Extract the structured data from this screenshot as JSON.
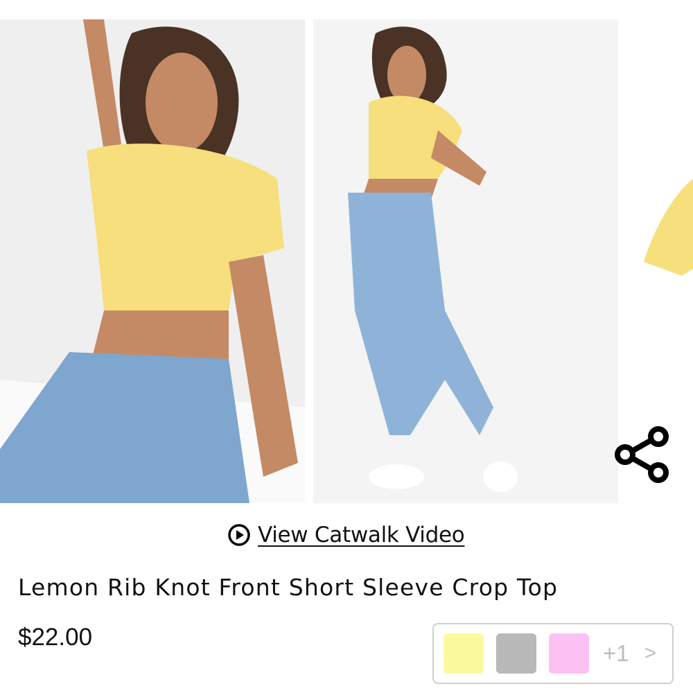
{
  "gallery": {
    "images": [
      {
        "alt": "front-view"
      },
      {
        "alt": "back-view"
      },
      {
        "alt": "detail-view"
      }
    ]
  },
  "video_link": {
    "label": "View Catwalk Video",
    "icon": "play-circle-icon"
  },
  "product": {
    "title": "Lemon Rib Knot Front Short Sleeve Crop Top",
    "price": "$22.00"
  },
  "colors": {
    "swatches": [
      {
        "name": "lemon",
        "hex": "#fbfb9e"
      },
      {
        "name": "grey",
        "hex": "#b9b9b9"
      },
      {
        "name": "pink",
        "hex": "#fbc1f3"
      }
    ],
    "more_label": "+1",
    "more_icon": "chevron-right-icon"
  },
  "share": {
    "icon": "share-icon"
  }
}
